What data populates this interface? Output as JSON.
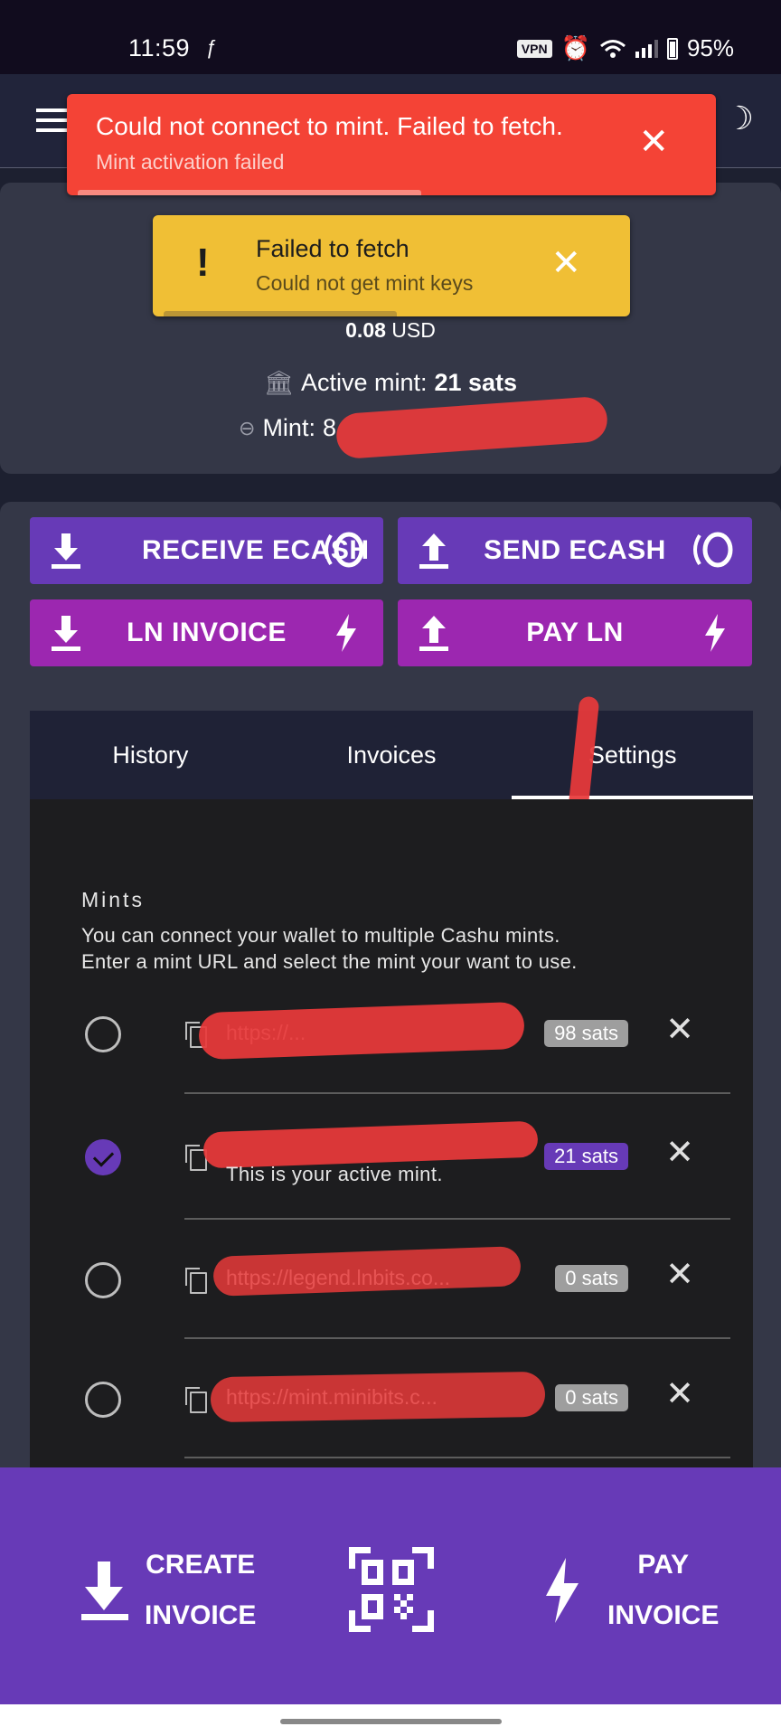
{
  "status_bar": {
    "time": "11:59",
    "vpn_label": "VPN",
    "battery": "95%"
  },
  "header": {
    "menu_icon": "hamburger-icon",
    "theme_icon": "moon-icon"
  },
  "toasts": [
    {
      "title": "Could not connect to mint. Failed to fetch.",
      "subtitle": "Mint activation failed",
      "type": "error",
      "color": "#f44336",
      "close_label": "✕"
    },
    {
      "title": "Failed to fetch",
      "subtitle": "Could not get mint keys",
      "type": "warning",
      "color": "#f0bf35",
      "icon_glyph": "!",
      "close_label": "✕"
    }
  ],
  "balance": {
    "usd_value": "0.08",
    "usd_unit": "USD",
    "active_mint_label": "Active mint:",
    "active_mint_value": "21 sats",
    "mint_label": "Mint:",
    "mint_value_partial": "8"
  },
  "actions": {
    "receive_ecash": "RECEIVE ECASH",
    "send_ecash": "SEND ECASH",
    "ln_invoice": "LN INVOICE",
    "pay_ln": "PAY LN",
    "ecash_color": "#673ab7",
    "ln_color": "#9c27b0"
  },
  "tabs": [
    {
      "label": "History",
      "active": false
    },
    {
      "label": "Invoices",
      "active": false
    },
    {
      "label": "Settings",
      "active": true
    }
  ],
  "settings": {
    "mints_title": "Mints",
    "mints_description_line1": "You can connect your wallet to multiple Cashu mints.",
    "mints_description_line2": "Enter a mint URL and select the mint your want to use.",
    "mints": [
      {
        "url": "https://...",
        "balance": "98 sats",
        "active": false,
        "note": ""
      },
      {
        "url": "",
        "balance": "21 sats",
        "active": true,
        "note": "This is your active mint."
      },
      {
        "url": "https://legend.lnbits.co...",
        "balance": "0 sats",
        "active": false,
        "note": ""
      },
      {
        "url": "https://mint.minibits.c...",
        "balance": "0 sats",
        "active": false,
        "note": ""
      }
    ]
  },
  "bottom_bar": {
    "create_line1": "CREATE",
    "create_line2": "INVOICE",
    "scan_icon": "qr-scan-icon",
    "pay_line1": "PAY",
    "pay_line2": "INVOICE",
    "color": "#673ab7"
  }
}
